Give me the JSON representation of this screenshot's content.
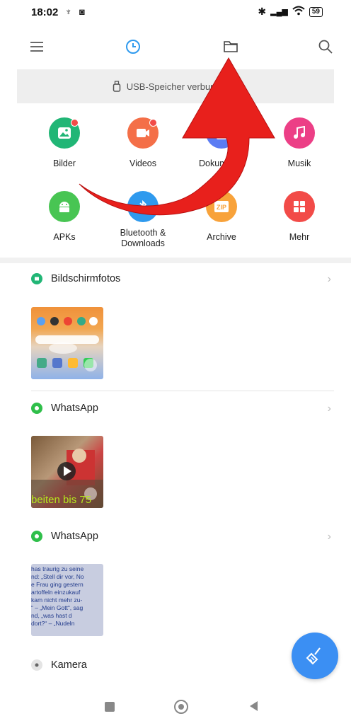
{
  "status": {
    "time": "18:02",
    "battery": "59"
  },
  "banner": {
    "text": "USB-Speicher verbunden >"
  },
  "categories": [
    {
      "label": "Bilder",
      "color": "#21b676",
      "icon": "image-icon"
    },
    {
      "label": "Videos",
      "color": "#f46f48",
      "icon": "video-icon"
    },
    {
      "label": "Dokumente",
      "color": "#5b7cf3",
      "icon": "document-icon"
    },
    {
      "label": "Musik",
      "color": "#ec3f86",
      "icon": "music-icon"
    },
    {
      "label": "APKs",
      "color": "#48c553",
      "icon": "android-icon"
    },
    {
      "label": "Bluetooth & Downloads",
      "color": "#2f9aee",
      "icon": "bluetooth-icon"
    },
    {
      "label": "Archive",
      "color": "#f8a23a",
      "icon": "zip-icon"
    },
    {
      "label": "Mehr",
      "color": "#f24b48",
      "icon": "grid-icon"
    }
  ],
  "sections": [
    {
      "title": "Bildschirmfotos",
      "icon_color": "#21b676"
    },
    {
      "title": "WhatsApp",
      "icon_color": "#2fbf4a"
    },
    {
      "title": "WhatsApp",
      "icon_color": "#2fbf4a"
    },
    {
      "title": "Kamera",
      "icon_color": "#d9d9d9"
    }
  ],
  "thumb2_caption": "beiten bis 75",
  "thumb3_lines": [
    "has traurig zu seine",
    "nd: „Stell dir vor, No",
    "e Frau ging gestern",
    "artoffeln einzukauf",
    "kam nicht mehr zu-",
    "“ – „Mein Gott“, sag",
    "nd, „was hast d",
    "dort?“ – „Nudeln"
  ]
}
